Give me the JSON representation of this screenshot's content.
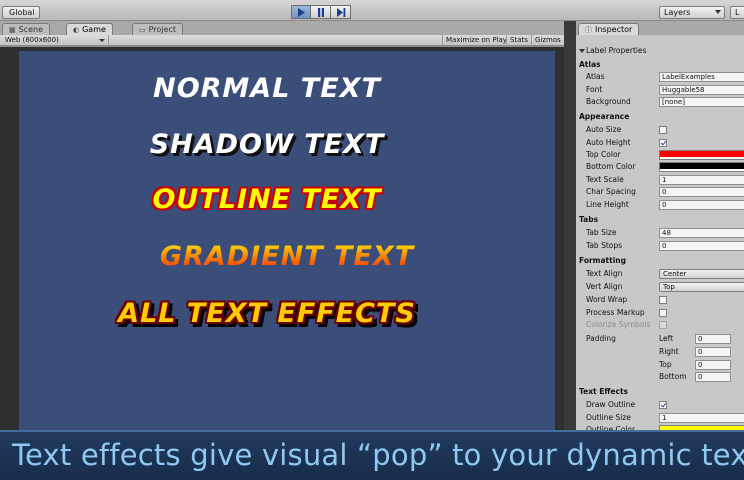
{
  "toolbar": {
    "global_label": "Global",
    "layers_label": "Layers",
    "layout_label": "L"
  },
  "game_panel": {
    "tabs": [
      {
        "label": "Scene",
        "icon": "scene-icon"
      },
      {
        "label": "Game",
        "icon": "game-icon"
      },
      {
        "label": "Project",
        "icon": "folder-icon"
      }
    ],
    "resolution": "Web (800x600)",
    "buttons": {
      "maximize": "Maximize on Play",
      "stats": "Stats",
      "gizmos": "Gizmos"
    }
  },
  "viewport": {
    "background": "#3b4e7a",
    "lines": {
      "normal": "NORMAL TEXT",
      "shadow": "SHADOW TEXT",
      "outline": "OUTLINE TEXT",
      "gradient": "GRADIENT TEXT",
      "all": "ALL TEXT EFFECTS"
    }
  },
  "inspector": {
    "tab_label": "Inspector",
    "component_title": "Label Properties",
    "atlas_section": "Atlas",
    "atlas": {
      "label": "Atlas",
      "value": "LabelExamples"
    },
    "font": {
      "label": "Font",
      "value": "Huggable58"
    },
    "background": {
      "label": "Background",
      "value": "[none]"
    },
    "appearance_section": "Appearance",
    "auto_size": {
      "label": "Auto Size",
      "checked": false
    },
    "auto_height": {
      "label": "Auto Height",
      "checked": true
    },
    "top_color": {
      "label": "Top Color",
      "color": "#ff0000"
    },
    "bottom_color": {
      "label": "Bottom Color",
      "color": "#000000"
    },
    "text_scale": {
      "label": "Text Scale",
      "value": "1"
    },
    "char_spacing": {
      "label": "Char Spacing",
      "value": "0"
    },
    "line_height": {
      "label": "Line Height",
      "value": "0"
    },
    "tabs_section": "Tabs",
    "tab_size": {
      "label": "Tab Size",
      "value": "48"
    },
    "tab_stops": {
      "label": "Tab Stops",
      "value": "0"
    },
    "formatting_section": "Formatting",
    "text_align": {
      "label": "Text Align",
      "value": "Center"
    },
    "vert_align": {
      "label": "Vert Align",
      "value": "Top"
    },
    "word_wrap": {
      "label": "Word Wrap",
      "checked": false
    },
    "process_markup": {
      "label": "Process Markup",
      "checked": false
    },
    "colorize_symbols": {
      "label": "Colorize Symbols",
      "checked": false
    },
    "padding": {
      "label": "Padding",
      "left": {
        "label": "Left",
        "value": "0"
      },
      "right": {
        "label": "Right",
        "value": "0"
      },
      "top": {
        "label": "Top",
        "value": "0"
      },
      "bottom": {
        "label": "Bottom",
        "value": "0"
      }
    },
    "effects_section": "Text Effects",
    "draw_outline": {
      "label": "Draw Outline",
      "checked": true
    },
    "outline_size": {
      "label": "Outline Size",
      "value": "1"
    },
    "outline_color": {
      "label": "Outline Color",
      "color": "#ffff00"
    }
  },
  "caption": {
    "text": "Text effects give visual “pop” to your dynamic text"
  }
}
